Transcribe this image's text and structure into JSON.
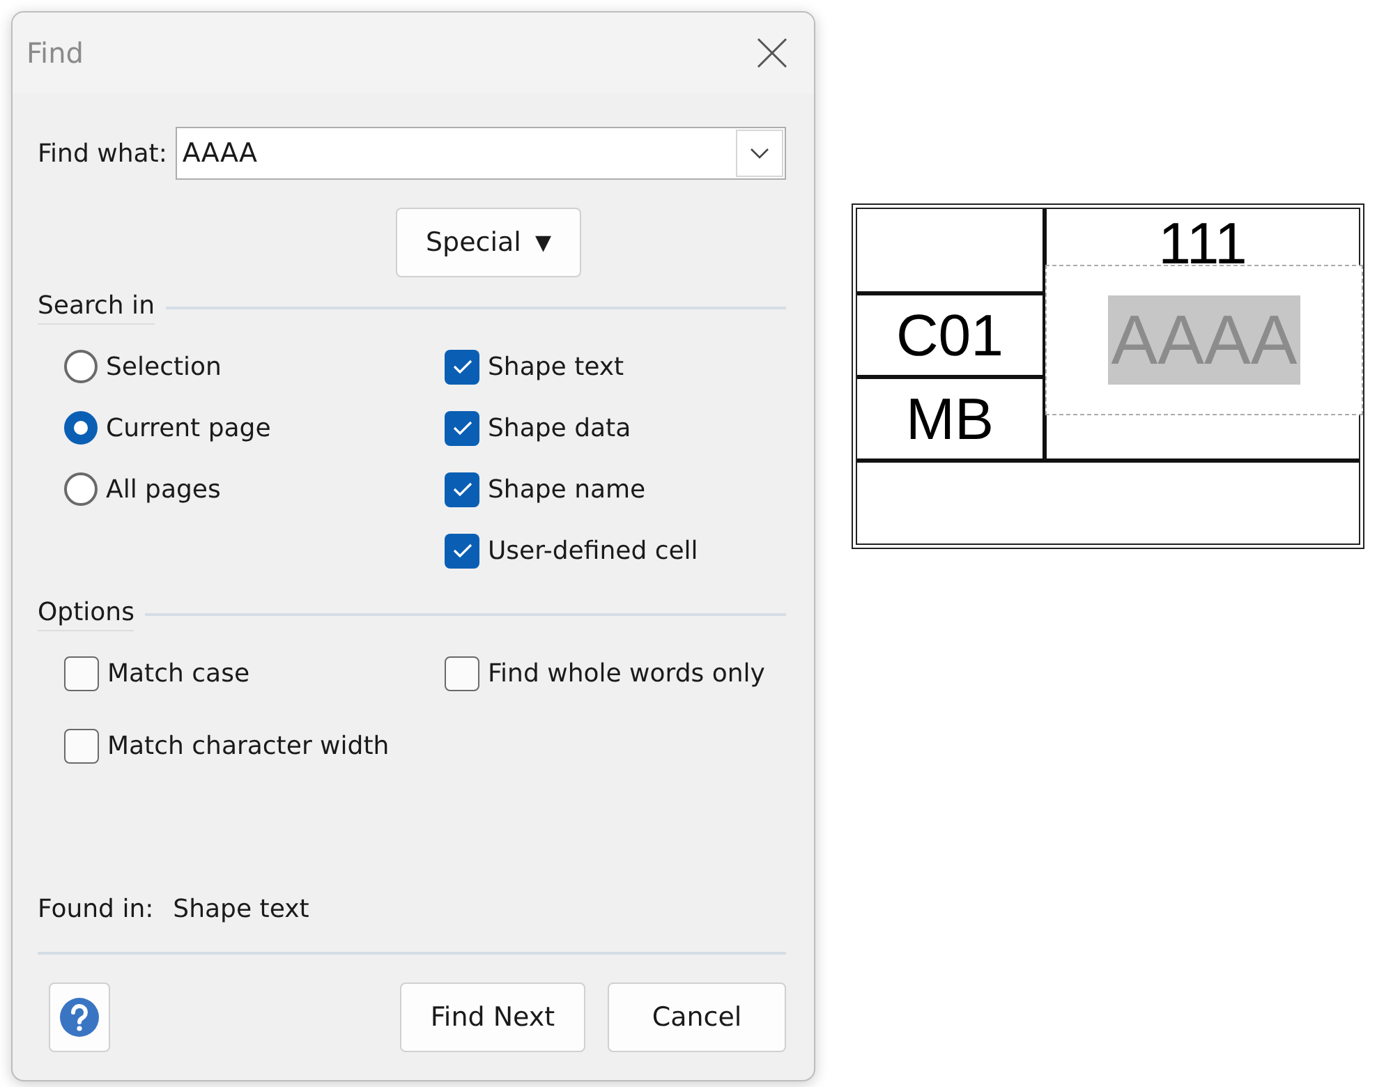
{
  "window": {
    "title": "Find"
  },
  "find_what": {
    "label": "Find what:",
    "value": "AAAA"
  },
  "special_button": {
    "label": "Special",
    "arrow": "▼"
  },
  "search_in": {
    "title": "Search in",
    "scopes": [
      {
        "label": "Selection",
        "selected": false
      },
      {
        "label": "Current page",
        "selected": true
      },
      {
        "label": "All pages",
        "selected": false
      }
    ],
    "targets": [
      {
        "label": "Shape text",
        "checked": true
      },
      {
        "label": "Shape data",
        "checked": true
      },
      {
        "label": "Shape name",
        "checked": true
      },
      {
        "label": "User-defined cell",
        "checked": true
      }
    ]
  },
  "options": {
    "title": "Options",
    "items": [
      {
        "label": "Match case",
        "checked": false
      },
      {
        "label": "Find whole words only",
        "checked": false
      },
      {
        "label": "Match character width",
        "checked": false
      }
    ]
  },
  "found_in": {
    "label": "Found in:",
    "value": "Shape text"
  },
  "buttons": [
    {
      "label": "Find Next"
    },
    {
      "label": "Cancel"
    }
  ],
  "drawing": {
    "left_cells": [
      "",
      "C01",
      "MB"
    ],
    "right_text": "111",
    "edit_text": "AAAA"
  }
}
